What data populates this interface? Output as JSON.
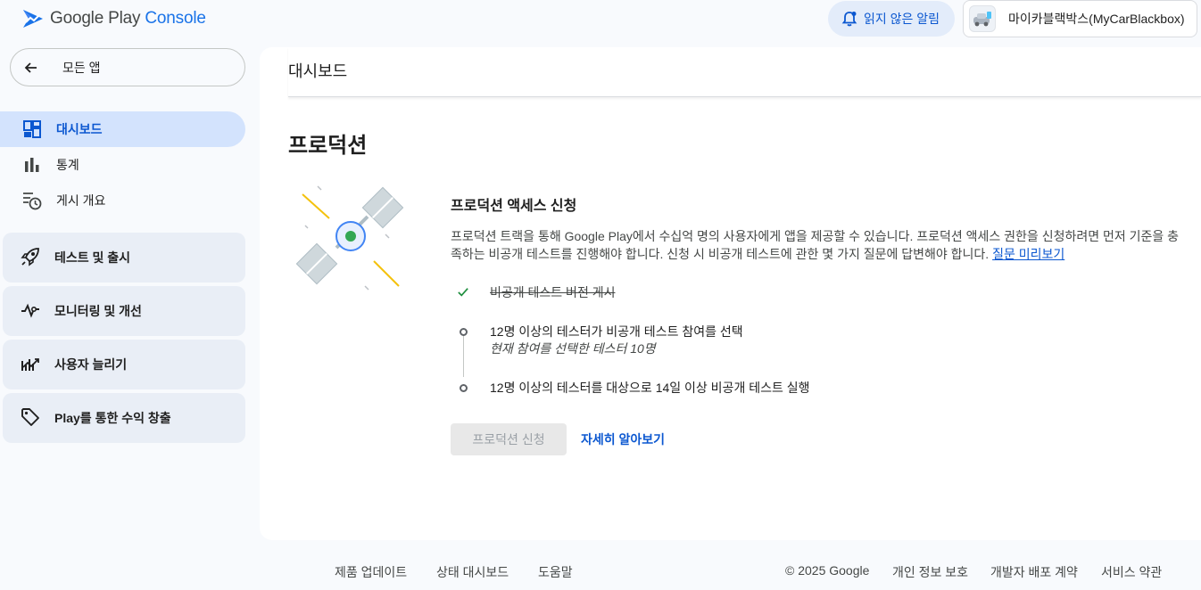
{
  "topbar": {
    "logo_text": "Google Play",
    "logo_accent": "Console",
    "notifications_label": "읽지 않은 알림",
    "app_name": "마이카블랙박스(MyCarBlackbox)"
  },
  "sidebar": {
    "back_label": "모든 앱",
    "items": [
      {
        "label": "대시보드",
        "icon": "dashboard-icon"
      },
      {
        "label": "통계",
        "icon": "bar-chart-icon"
      },
      {
        "label": "게시 개요",
        "icon": "publishing-overview-icon"
      }
    ],
    "groups": [
      {
        "label": "테스트 및 출시",
        "icon": "rocket-icon"
      },
      {
        "label": "모니터링 및 개선",
        "icon": "vitals-icon"
      },
      {
        "label": "사용자 늘리기",
        "icon": "growth-icon"
      },
      {
        "label": "Play를 통한 수익 창출",
        "icon": "tag-icon"
      }
    ]
  },
  "main": {
    "page_title": "대시보드",
    "section_title": "프로덕션",
    "card_title": "프로덕션 액세스 신청",
    "description": "프로덕션 트랙을 통해 Google Play에서 수십억 명의 사용자에게 앱을 제공할 수 있습니다. 프로덕션 액세스 권한을 신청하려면 먼저 기준을 충족하는 비공개 테스트를 진행해야 합니다. 신청 시 비공개 테스트에 관한 몇 가지 질문에 답변해야 합니다.",
    "preview_link": "질문 미리보기",
    "steps": [
      {
        "text": "비공개 테스트 버전 게시",
        "done": true
      },
      {
        "text": "12명 이상의 테스터가 비공개 테스트 참여를 선택",
        "sub": "현재 참여를 선택한 테스터 10명",
        "done": false
      },
      {
        "text": "12명 이상의 테스터를 대상으로 14일 이상 비공개 테스트 실행",
        "done": false
      }
    ],
    "apply_button": "프로덕션 신청",
    "learn_more": "자세히 알아보기"
  },
  "footer": {
    "links_left": [
      "제품 업데이트",
      "상태 대시보드",
      "도움말"
    ],
    "copyright": "© 2025 Google",
    "links_right": [
      "개인 정보 보호",
      "개발자 배포 계약",
      "서비스 약관"
    ]
  },
  "colors": {
    "accent": "#0b57d0",
    "active_nav_bg": "#d3e3fd",
    "group_bg": "#e9eef6",
    "check_green": "#1e8e3e"
  }
}
